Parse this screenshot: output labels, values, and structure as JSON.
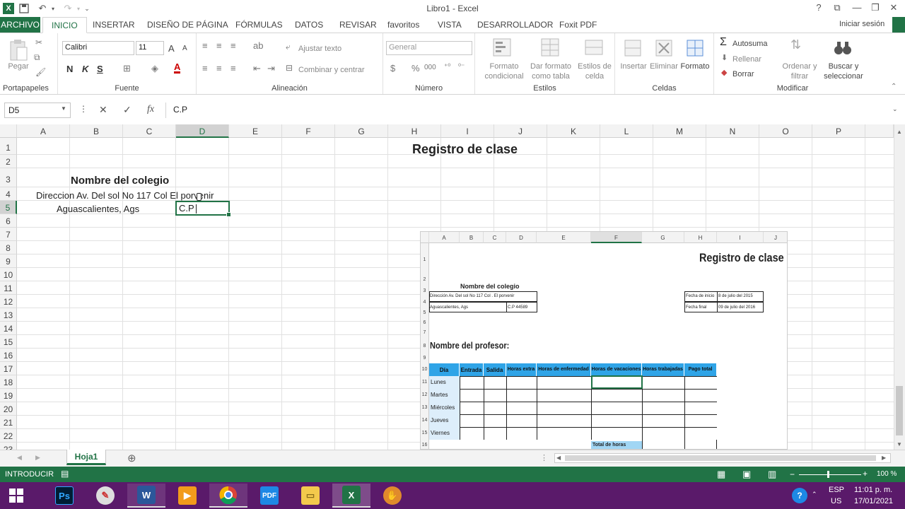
{
  "window": {
    "title": "Libro1 - Excel",
    "sign_in": "Iniciar sesión"
  },
  "qat": {
    "logo": "X",
    "save_icon": "save-icon",
    "undo_icon": "undo-icon",
    "redo_icon": "redo-icon"
  },
  "tabs": [
    "ARCHIVO",
    "INICIO",
    "INSERTAR",
    "DISEÑO DE PÁGINA",
    "FÓRMULAS",
    "DATOS",
    "REVISAR",
    "favoritos",
    "VISTA",
    "DESARROLLADOR",
    "Foxit PDF"
  ],
  "ribbon": {
    "clipboard": {
      "label": "Portapapeles",
      "paste": "Pegar"
    },
    "font": {
      "label": "Fuente",
      "name": "Calibri",
      "size": "11",
      "grow": "A",
      "shrink": "A",
      "bold": "N",
      "italic": "K",
      "underline": "S",
      "color": "A"
    },
    "alignment": {
      "label": "Alineación",
      "wrap": "Ajustar texto",
      "merge": "Combinar y centrar"
    },
    "number": {
      "label": "Número",
      "format": "General",
      "currency": "$",
      "percent": "%",
      "thousands": "000"
    },
    "styles": {
      "label": "Estilos",
      "cond1": "Formato",
      "cond2": "condicional",
      "table1": "Dar formato",
      "table2": "como tabla",
      "cell1": "Estilos de",
      "cell2": "celda"
    },
    "cells": {
      "label": "Celdas",
      "insert": "Insertar",
      "delete": "Eliminar",
      "format": "Formato"
    },
    "editing": {
      "label": "Modificar",
      "autosum": "Autosuma",
      "fill": "Rellenar",
      "clear": "Borrar",
      "sort1": "Ordenar y",
      "sort2": "filtrar",
      "find1": "Buscar y",
      "find2": "seleccionar"
    }
  },
  "formula_bar": {
    "name_box": "D5",
    "cancel": "✕",
    "enter": "✓",
    "fx": "fx",
    "value": "C.P"
  },
  "columns": [
    "A",
    "B",
    "C",
    "D",
    "E",
    "F",
    "G",
    "H",
    "I",
    "J",
    "K",
    "L",
    "M",
    "N",
    "O",
    "P"
  ],
  "rows": [
    "1",
    "2",
    "3",
    "4",
    "5",
    "6",
    "7",
    "8",
    "9",
    "10",
    "11",
    "12",
    "13",
    "14",
    "15",
    "16",
    "17",
    "18",
    "19",
    "20",
    "21",
    "22",
    "23"
  ],
  "cells": {
    "title": "Registro de clase",
    "school": "Nombre del colegio",
    "address": "Direccion Av. Del sol No 117 Col El porvenir",
    "city": "Aguascalientes, Ags",
    "editing": "C.P"
  },
  "reference_image": {
    "columns": [
      "A",
      "B",
      "C",
      "D",
      "E",
      "F",
      "G",
      "H",
      "I",
      "J"
    ],
    "rows": [
      "1",
      "2",
      "3",
      "4",
      "5",
      "6",
      "7",
      "8",
      "9",
      "10",
      "11",
      "12",
      "13",
      "14",
      "15",
      "16"
    ],
    "title": "Registro de clase",
    "school": "Nombre del colegio",
    "address": "Dirección Av. Del sol No 117 Col . El porvenir",
    "city": "Aguascalientes, Ags",
    "cp": "C.P 44589",
    "start_label": "Fecha de inicio",
    "start_value": "8 de julio del 2015",
    "end_label": "Fecha final",
    "end_value": "09 de julio del 2016",
    "teacher": "Nombre del profesor:",
    "headers": [
      "Día",
      "Entrada",
      "Salida",
      "Horas extra",
      "Horas de enfermedad",
      "Horas de vacaciones",
      "Horas trabajadas",
      "Pago total"
    ],
    "days": [
      "Lunes",
      "Martes",
      "Miércoles",
      "Jueves",
      "Viernes"
    ],
    "total_label": "Total de horas"
  },
  "sheet": {
    "tab": "Hoja1",
    "add": "⊕"
  },
  "status": {
    "mode": "INTRODUCIR",
    "zoom": "100 %"
  },
  "taskbar": {
    "lang": "ESP",
    "region": "US",
    "time": "11:01 p. m.",
    "date": "17/01/2021"
  },
  "colors": {
    "excel_green": "#217346",
    "header_blue": "#2fa4e7",
    "taskbar": "#5a1a6a"
  }
}
